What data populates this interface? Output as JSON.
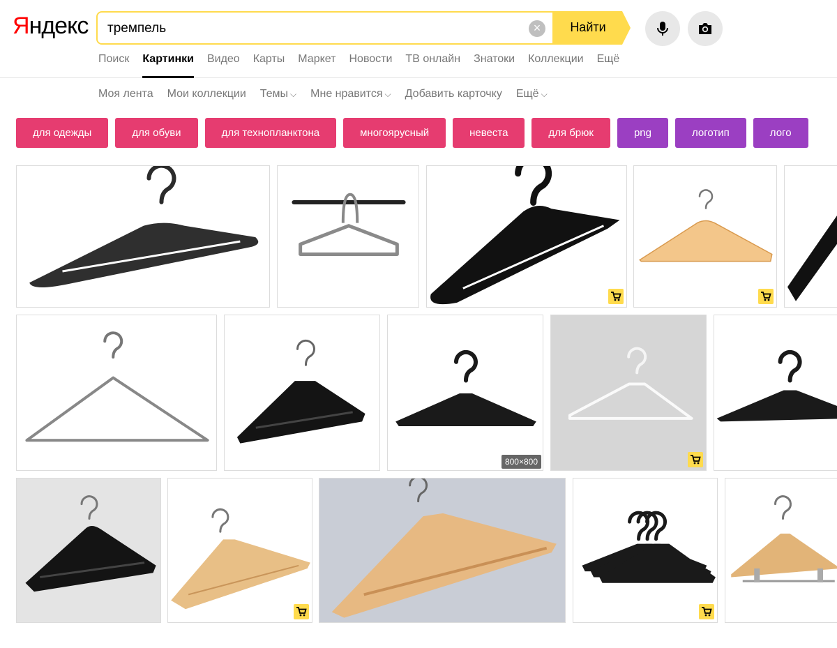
{
  "logo": {
    "first": "Я",
    "rest": "ндекс"
  },
  "search": {
    "query": "тремпель",
    "button_label": "Найти",
    "clear_symbol": "×"
  },
  "services": [
    {
      "label": "Поиск",
      "active": false
    },
    {
      "label": "Картинки",
      "active": true
    },
    {
      "label": "Видео",
      "active": false
    },
    {
      "label": "Карты",
      "active": false
    },
    {
      "label": "Маркет",
      "active": false
    },
    {
      "label": "Новости",
      "active": false
    },
    {
      "label": "ТВ онлайн",
      "active": false
    },
    {
      "label": "Знатоки",
      "active": false
    },
    {
      "label": "Коллекции",
      "active": false
    },
    {
      "label": "Ещё",
      "active": false
    }
  ],
  "subnav": [
    {
      "label": "Моя лента",
      "dropdown": false
    },
    {
      "label": "Мои коллекции",
      "dropdown": false
    },
    {
      "label": "Темы",
      "dropdown": true
    },
    {
      "label": "Мне нравится",
      "dropdown": true
    },
    {
      "label": "Добавить карточку",
      "dropdown": false
    },
    {
      "label": "Ещё",
      "dropdown": true
    }
  ],
  "chips": [
    {
      "label": "для одежды",
      "color": "#e63c70"
    },
    {
      "label": "для обуви",
      "color": "#e63c70"
    },
    {
      "label": "для технопланктона",
      "color": "#e63c70"
    },
    {
      "label": "многоярусный",
      "color": "#e63c70"
    },
    {
      "label": "невеста",
      "color": "#e63c70"
    },
    {
      "label": "для брюк",
      "color": "#e63c70"
    },
    {
      "label": "png",
      "color": "#9b3fc2"
    },
    {
      "label": "логотип",
      "color": "#9b3fc2"
    },
    {
      "label": "лого",
      "color": "#9b3fc2"
    }
  ],
  "results": [
    {
      "kind": "plastic-black",
      "bg": "#ffffff",
      "cart": false
    },
    {
      "kind": "grey-on-bar",
      "bg": "#ffffff",
      "cart": false
    },
    {
      "kind": "plastic-black-big",
      "bg": "#ffffff",
      "cart": true
    },
    {
      "kind": "wood-light",
      "bg": "#ffffff",
      "cart": true
    },
    {
      "kind": "plastic-black-partial",
      "bg": "#ffffff",
      "cart": false
    },
    {
      "kind": "wire",
      "bg": "#ffffff",
      "cart": false
    },
    {
      "kind": "velvet-black",
      "bg": "#ffffff",
      "cart": false
    },
    {
      "kind": "plastic-thin",
      "bg": "#ffffff",
      "cart": false,
      "dims": "800×800"
    },
    {
      "kind": "transparent",
      "bg": "#d6d6d6",
      "cart": true
    },
    {
      "kind": "plastic-thin-partial",
      "bg": "#ffffff",
      "cart": false
    },
    {
      "kind": "suit-black",
      "bg": "#e4e4e4",
      "cart": false
    },
    {
      "kind": "wood-natural",
      "bg": "#ffffff",
      "cart": true
    },
    {
      "kind": "wood-big",
      "bg": "#c9cdd6",
      "cart": false
    },
    {
      "kind": "stack-black",
      "bg": "#ffffff",
      "cart": true
    },
    {
      "kind": "wood-clips",
      "bg": "#ffffff",
      "cart": false
    }
  ],
  "colors": {
    "accent_yellow": "#ffdb4d",
    "chip_pink": "#e63c70",
    "chip_purple": "#9b3fc2",
    "cart_bg": "#ffdb4d"
  }
}
